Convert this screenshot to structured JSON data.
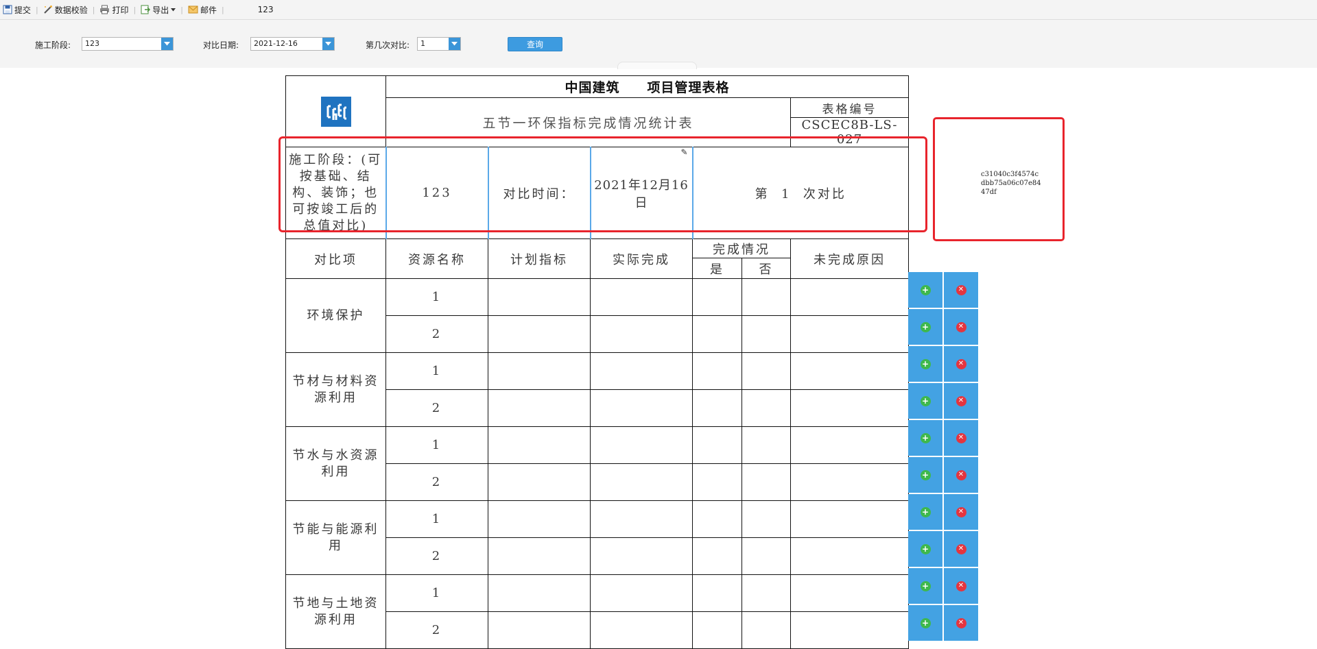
{
  "toolbar": {
    "items": [
      {
        "label": "提交",
        "icon": "save-icon"
      },
      {
        "label": "数据校验",
        "icon": "wand-icon"
      },
      {
        "label": "打印",
        "icon": "printer-icon"
      },
      {
        "label": "导出",
        "icon": "export-icon"
      },
      {
        "label": "邮件",
        "icon": "mail-icon"
      }
    ],
    "extra_value": "123"
  },
  "filters": {
    "stage_label": "施工阶段:",
    "stage_value": "123",
    "date_label": "对比日期:",
    "date_value": "2021-12-16",
    "times_label": "第几次对比:",
    "times_value": "1",
    "query_label": "查询"
  },
  "form": {
    "company": "中国建筑",
    "form_title": "项目管理表格",
    "subtitle": "五节一环保指标完成情况统计表",
    "code_label": "表格编号",
    "code_value": "CSCEC8B-LS-027",
    "stage_desc": "施工阶段：(可按基础、结构、装饰；也可按竣工后的总值对比)",
    "stage_value": "123",
    "compare_time_label": "对比时间：",
    "compare_date": "2021年12月16日",
    "nth_prefix": "第",
    "nth_value": "1",
    "nth_suffix": "次对比",
    "headers": {
      "item": "对比项",
      "resource": "资源名称",
      "plan": "计划指标",
      "actual": "实际完成",
      "status": "完成情况",
      "yes": "是",
      "no": "否",
      "reason": "未完成原因"
    },
    "groups": [
      {
        "name": "环境保护",
        "rows": [
          "1",
          "2"
        ]
      },
      {
        "name": "节材与材料资源利用",
        "rows": [
          "1",
          "2"
        ]
      },
      {
        "name": "节水与水资源利用",
        "rows": [
          "1",
          "2"
        ]
      },
      {
        "name": "节能与能源利用",
        "rows": [
          "1",
          "2"
        ]
      },
      {
        "name": "节地与土地资源利用",
        "rows": [
          "1",
          "2"
        ]
      }
    ]
  },
  "side_hash": "c31040c3f4574cdbb75a06c07e8447df",
  "colors": {
    "accent": "#3d9be0",
    "highlight": "#e8242c",
    "add": "#3eb84c",
    "delete": "#e4353f"
  }
}
